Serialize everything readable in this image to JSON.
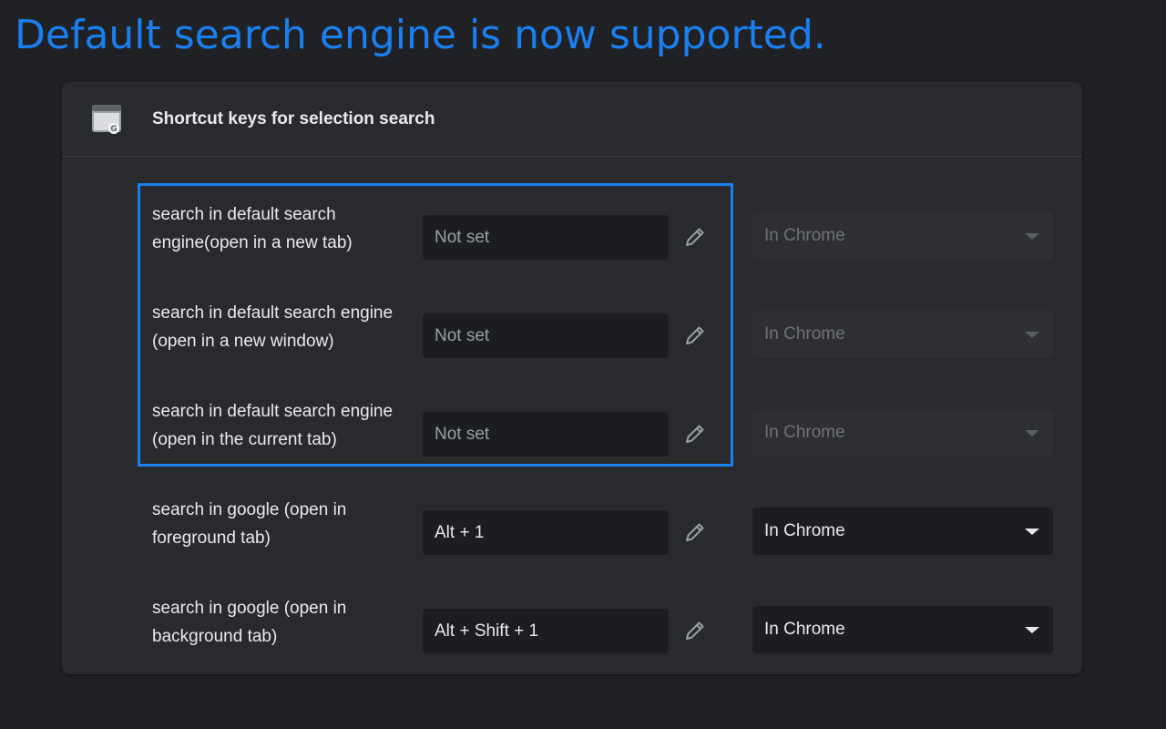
{
  "headline": "Default search engine is now supported.",
  "card": {
    "title": "Shortcut keys for selection search",
    "icon": "extension-window-icon"
  },
  "colors": {
    "accent": "#1a7ff0",
    "background": "#202124",
    "card": "#292a2d"
  },
  "rows": [
    {
      "label": "search in default search engine(open in a new tab)",
      "label_lines": [
        "search in default search",
        "engine(open in a new tab)"
      ],
      "shortcut": "Not set",
      "set": false,
      "scope": "In Chrome",
      "scope_enabled": false
    },
    {
      "label": "search in default search engine (open in a new window)",
      "label_lines": [
        "search in default search engine",
        "(open in a new window)"
      ],
      "shortcut": "Not set",
      "set": false,
      "scope": "In Chrome",
      "scope_enabled": false
    },
    {
      "label": "search in default search engine (open in the current tab)",
      "label_lines": [
        "search in default search engine",
        "(open in the current tab)"
      ],
      "shortcut": "Not set",
      "set": false,
      "scope": "In Chrome",
      "scope_enabled": false
    },
    {
      "label": "search in google (open in foreground tab)",
      "label_lines": [
        "search in google (open in",
        "foreground tab)"
      ],
      "shortcut": "Alt + 1",
      "set": true,
      "scope": "In Chrome",
      "scope_enabled": true
    },
    {
      "label": "search in google (open in background tab)",
      "label_lines": [
        "search in google (open in",
        "background tab)"
      ],
      "shortcut": "Alt + Shift + 1",
      "set": true,
      "scope": "In Chrome",
      "scope_enabled": true
    }
  ]
}
